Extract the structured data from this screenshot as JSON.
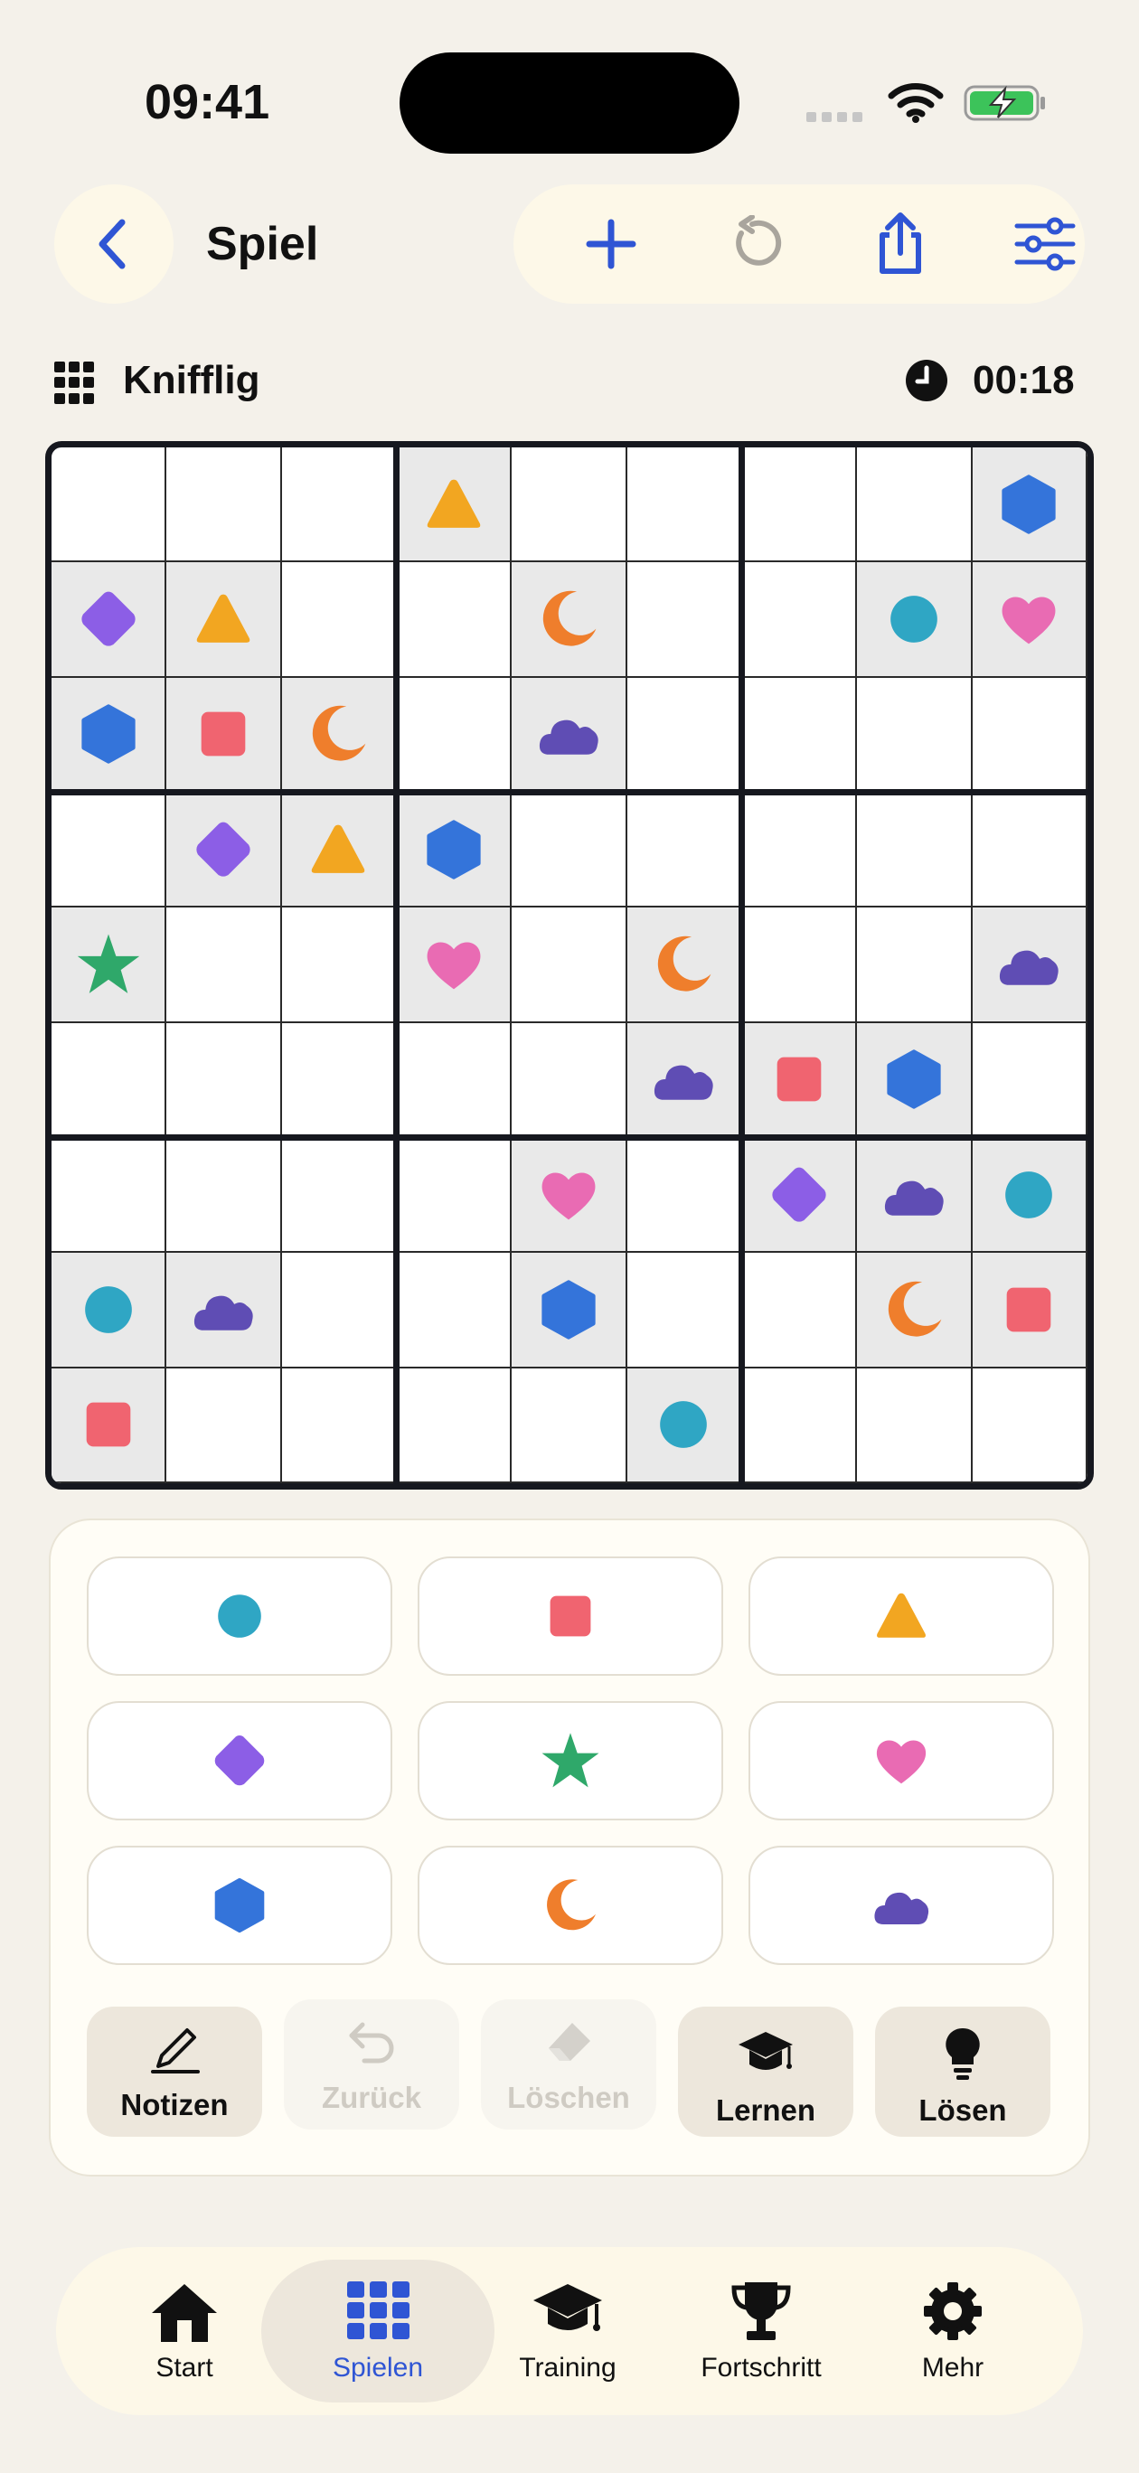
{
  "status": {
    "time": "09:41"
  },
  "header": {
    "title": "Spiel"
  },
  "toolbar": {
    "icons": [
      "plus-icon",
      "reset-icon",
      "share-icon",
      "settings-sliders-icon"
    ]
  },
  "game": {
    "difficulty": "Knifflig",
    "timer": "00:18"
  },
  "symbols": {
    "circle": {
      "color": "#2fa6c4"
    },
    "square": {
      "color": "#f06470"
    },
    "triangle": {
      "color": "#f2a621"
    },
    "diamond": {
      "color": "#8c5ee6"
    },
    "star": {
      "color": "#2fa86a"
    },
    "heart": {
      "color": "#e96bb3"
    },
    "hexagon": {
      "color": "#3474da"
    },
    "moon": {
      "color": "#ef7e2c"
    },
    "cloud": {
      "color": "#5f4db4"
    }
  },
  "board": [
    [
      "",
      "",
      "",
      "triangle",
      "",
      "",
      "",
      "",
      "hexagon"
    ],
    [
      "diamond",
      "triangle",
      "",
      "",
      "moon",
      "",
      "",
      "circle",
      "heart"
    ],
    [
      "hexagon",
      "square",
      "moon",
      "",
      "cloud",
      "",
      "",
      "",
      ""
    ],
    [
      "",
      "diamond",
      "triangle",
      "hexagon",
      "",
      "",
      "",
      "",
      ""
    ],
    [
      "star",
      "",
      "",
      "heart",
      "",
      "moon",
      "",
      "",
      "cloud"
    ],
    [
      "",
      "",
      "",
      "",
      "",
      "cloud",
      "square",
      "hexagon",
      ""
    ],
    [
      "",
      "",
      "",
      "",
      "heart",
      "",
      "diamond",
      "cloud",
      "circle"
    ],
    [
      "circle",
      "cloud",
      "",
      "",
      "hexagon",
      "",
      "",
      "moon",
      "square"
    ],
    [
      "square",
      "",
      "",
      "",
      "",
      "circle",
      "",
      "",
      ""
    ]
  ],
  "palette": [
    "circle",
    "square",
    "triangle",
    "diamond",
    "star",
    "heart",
    "hexagon",
    "moon",
    "cloud"
  ],
  "actions": [
    {
      "label": "Notizen",
      "icon": "pencil-icon",
      "enabled": true
    },
    {
      "label": "Zurück",
      "icon": "undo-icon",
      "enabled": false
    },
    {
      "label": "Löschen",
      "icon": "eraser-icon",
      "enabled": false
    },
    {
      "label": "Lernen",
      "icon": "graduation-cap-icon",
      "enabled": true
    },
    {
      "label": "Lösen",
      "icon": "lightbulb-icon",
      "enabled": true
    }
  ],
  "tabs": [
    {
      "label": "Start",
      "icon": "house-icon",
      "active": false
    },
    {
      "label": "Spielen",
      "icon": "grid-icon",
      "active": true
    },
    {
      "label": "Training",
      "icon": "graduation-cap-icon",
      "active": false
    },
    {
      "label": "Fortschritt",
      "icon": "trophy-icon",
      "active": false
    },
    {
      "label": "Mehr",
      "icon": "gear-icon",
      "active": false
    }
  ]
}
